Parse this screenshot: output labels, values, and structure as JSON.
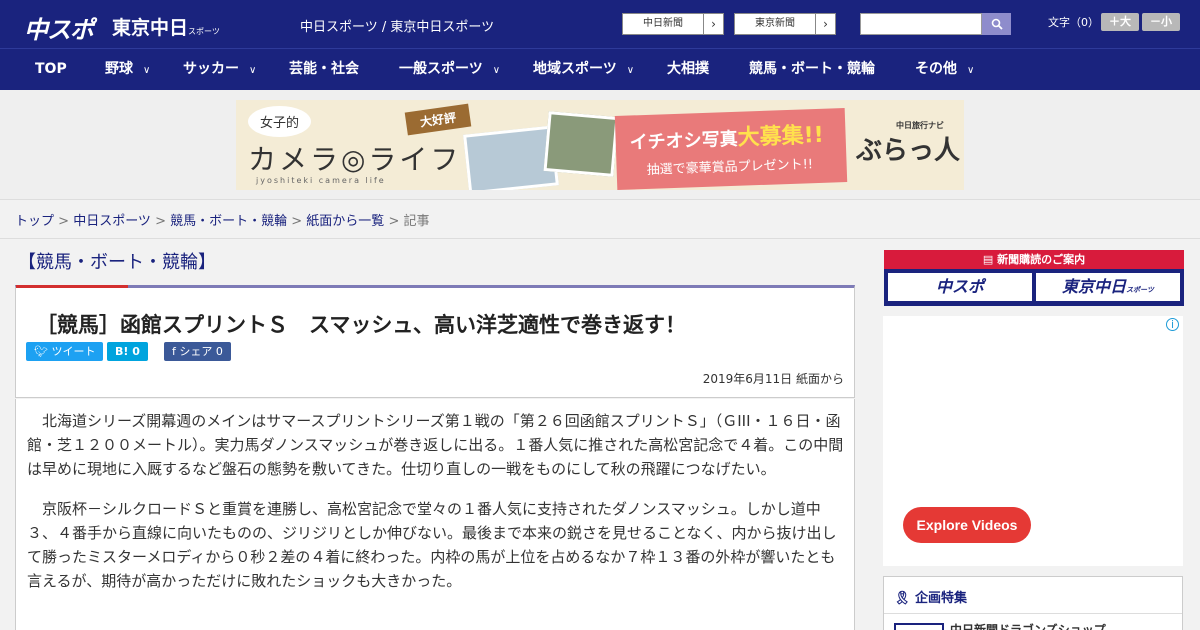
{
  "header": {
    "logo_main": "中スポ",
    "logo_tokyo": "東京中日",
    "logo_tokyo_suffix": "スポーツ",
    "site_names": "中日スポーツ / 東京中日スポーツ",
    "links": [
      {
        "label": "中日新聞"
      },
      {
        "label": "東京新聞"
      }
    ],
    "search_placeholder": "",
    "font_size_label": "文字（0）",
    "font_larger": "＋大",
    "font_smaller": "－小"
  },
  "nav": {
    "items": [
      {
        "label": "TOP",
        "dropdown": false
      },
      {
        "label": "野球",
        "dropdown": true
      },
      {
        "label": "サッカー",
        "dropdown": true
      },
      {
        "label": "芸能・社会",
        "dropdown": false
      },
      {
        "label": "一般スポーツ",
        "dropdown": true
      },
      {
        "label": "地域スポーツ",
        "dropdown": true
      },
      {
        "label": "大相撲",
        "dropdown": false
      },
      {
        "label": "競馬・ボート・競輪",
        "dropdown": false
      },
      {
        "label": "その他",
        "dropdown": true
      }
    ]
  },
  "banner": {
    "girls": "女子的",
    "camera_life": "カメラ◎ライフ",
    "sub": "jyoshiteki camera life",
    "popular": "大好評",
    "pink_line1_a": "イチオシ写真",
    "pink_line1_b": "大募集!!",
    "pink_line2": "抽選で豪華賞品プレゼント!!",
    "navi_small": "中日旅行ナビ",
    "navi": "ぶらっ人"
  },
  "breadcrumb": {
    "items": [
      "トップ",
      "中日スポーツ",
      "競馬・ボート・競輪",
      "紙面から一覧"
    ],
    "current": "記事"
  },
  "article": {
    "category": "【競馬・ボート・競輪】",
    "headline": "［競馬］函館スプリントＳ　スマッシュ、高い洋芝適性で巻き返す！",
    "share": {
      "tweet": "ツイート",
      "hatena": "B! 0",
      "facebook": "シェア 0"
    },
    "date": "2019年6月11日 紙面から",
    "paragraphs": [
      "北海道シリーズ開幕週のメインはサマースプリントシリーズ第１戦の「第２６回函館スプリントＳ」（ＧIII・１６日・函館・芝１２００メートル）。実力馬ダノンスマッシュが巻き返しに出る。１番人気に推された高松宮記念で４着。この中間は早めに現地に入厩するなど盤石の態勢を敷いてきた。仕切り直しの一戦をものにして秋の飛躍につなげたい。",
      "京阪杯－シルクロードＳと重賞を連勝し、高松宮記念で堂々の１番人気に支持されたダノンスマッシュ。しかし道中３、４番手から直線に向いたものの、ジリジリとしか伸びない。最後まで本来の鋭さを見せることなく、内から抜け出して勝ったミスターメロディから０秒２差の４着に終わった。内枠の馬が上位を占めるなか７枠１３番の外枠が響いたとも言えるが、期待が高かっただけに敗れたショックも大きかった。"
    ]
  },
  "sidebar": {
    "subscribe_head": "新聞購読のご案内",
    "sub_logo_1": "中スポ",
    "sub_logo_2": "東京中日",
    "sub_logo_2_suffix": "スポーツ",
    "ad_button": "Explore Videos",
    "feature_title": "企画特集",
    "feature_item": "中日新聞ドラゴンズショップ"
  },
  "colors": {
    "navy": "#1a237e",
    "accent_red": "#d32f2f",
    "tweet_blue": "#1da1f2",
    "hatena_blue": "#00a4de",
    "facebook_blue": "#3b5998"
  }
}
